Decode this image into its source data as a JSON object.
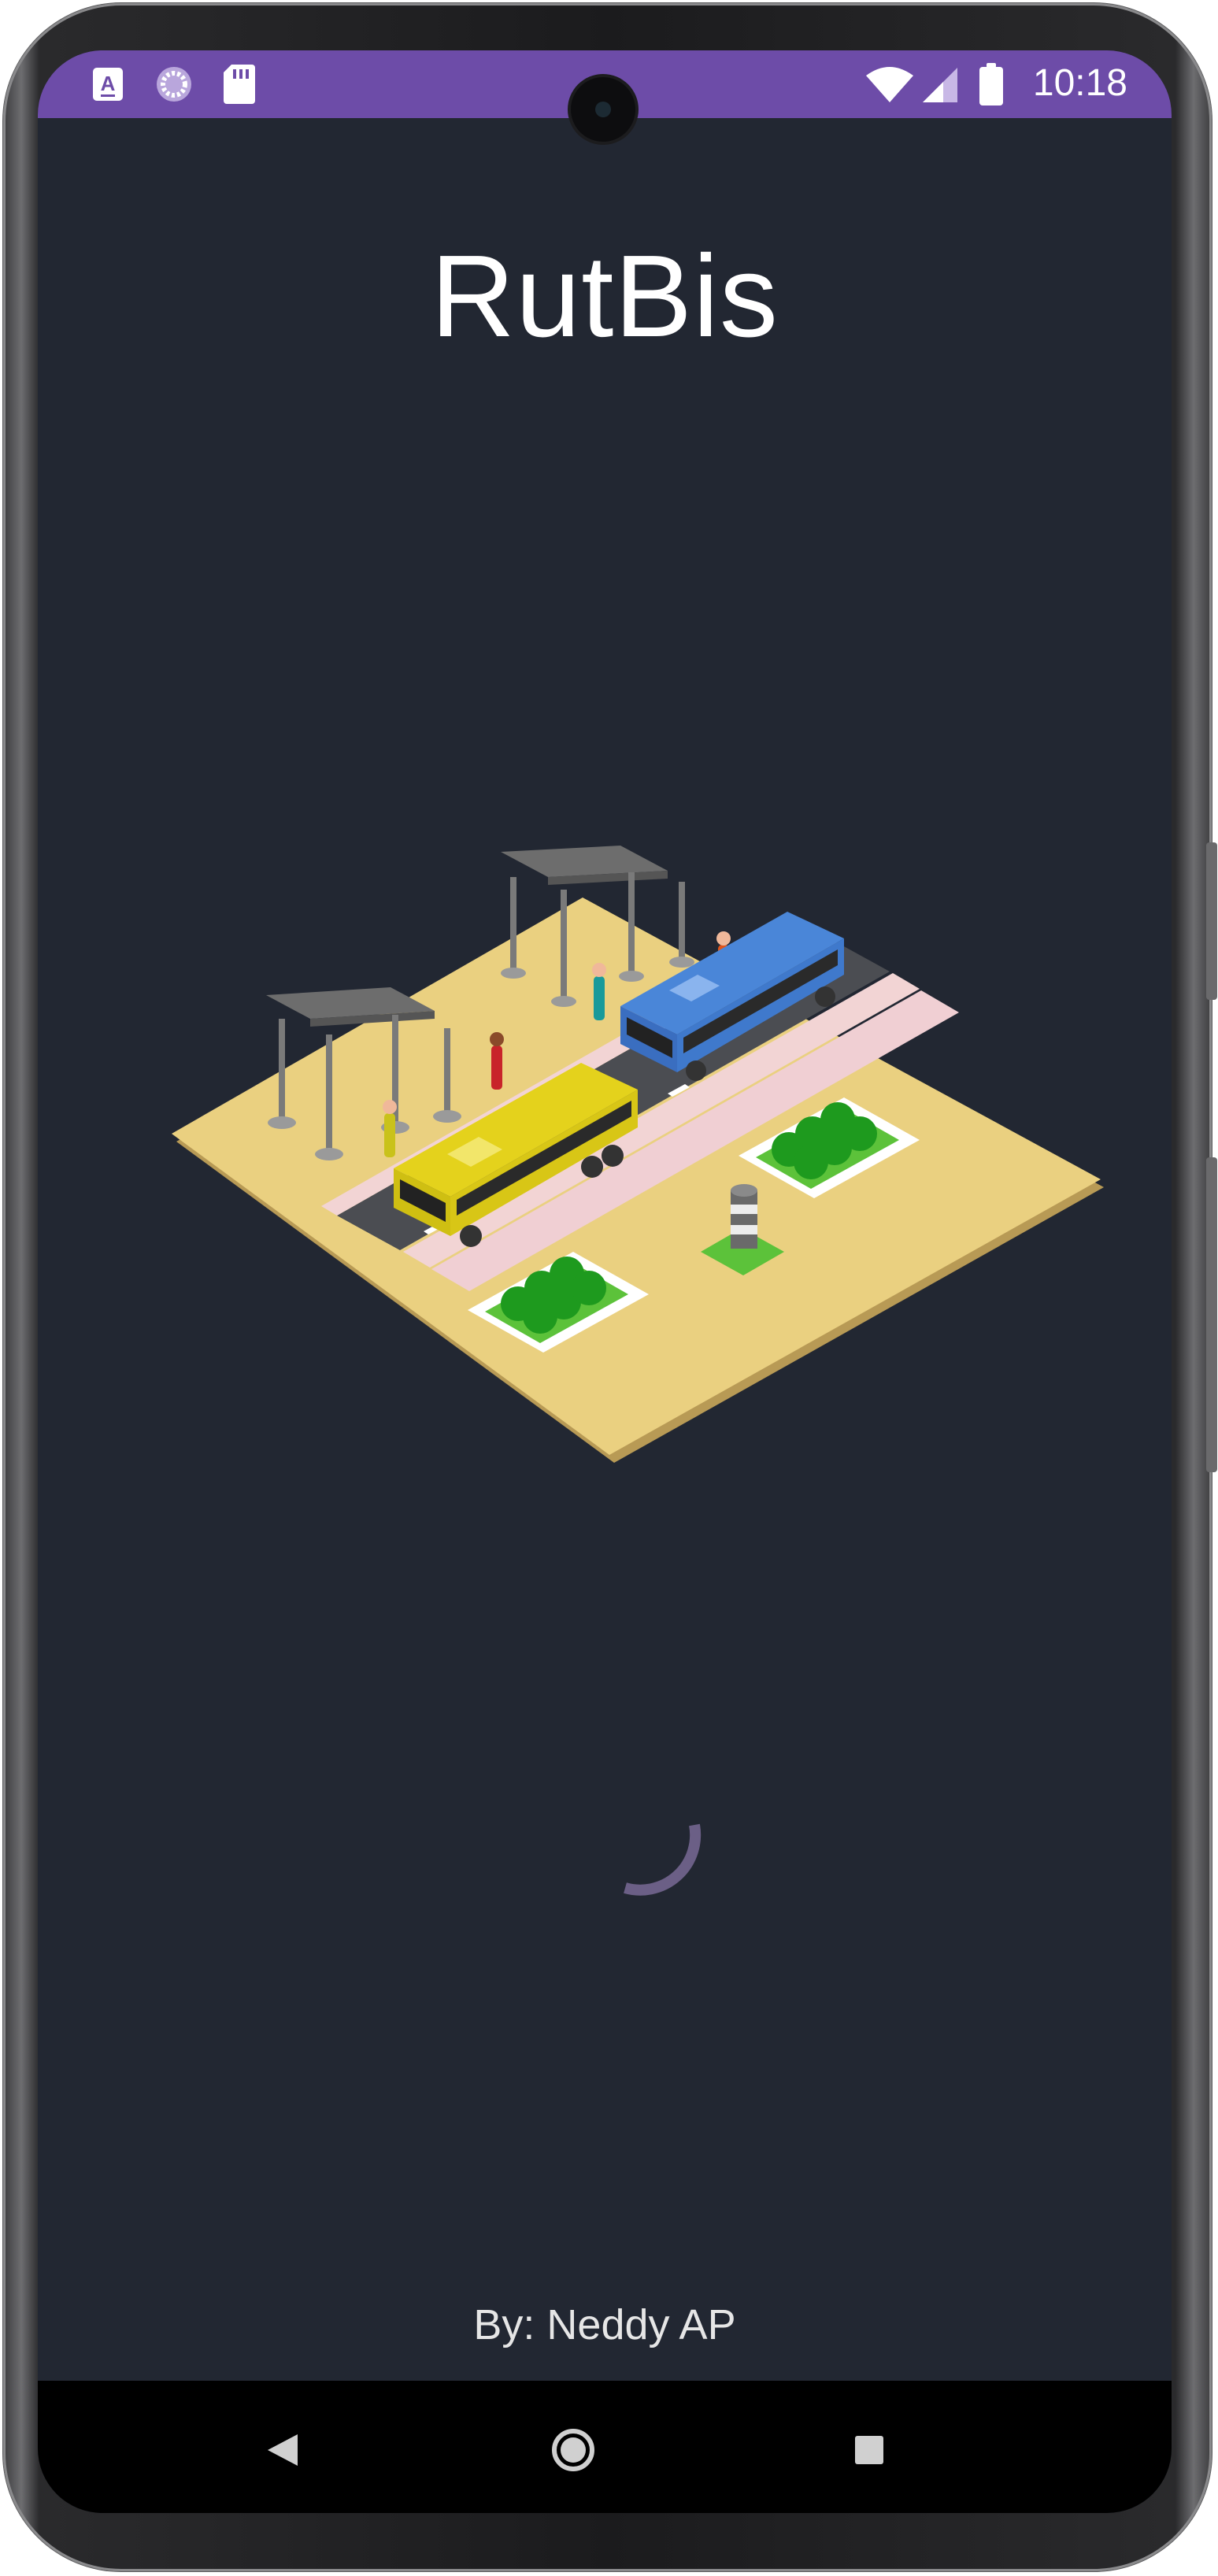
{
  "status_bar": {
    "time": "10:18",
    "left_icons": [
      "text-a-icon",
      "loading-icon",
      "sd-card-icon"
    ],
    "right_icons": [
      "wifi-icon",
      "signal-icon",
      "battery-icon"
    ],
    "color": "#6d4ca8"
  },
  "splash": {
    "app_name": "RutBis",
    "author": "By: Neddy AP",
    "illustration": "isometric-bus-stop-illustration",
    "background_color": "#222732"
  },
  "navigation_bar": {
    "buttons": [
      "back-icon",
      "home-icon",
      "recents-icon"
    ]
  }
}
